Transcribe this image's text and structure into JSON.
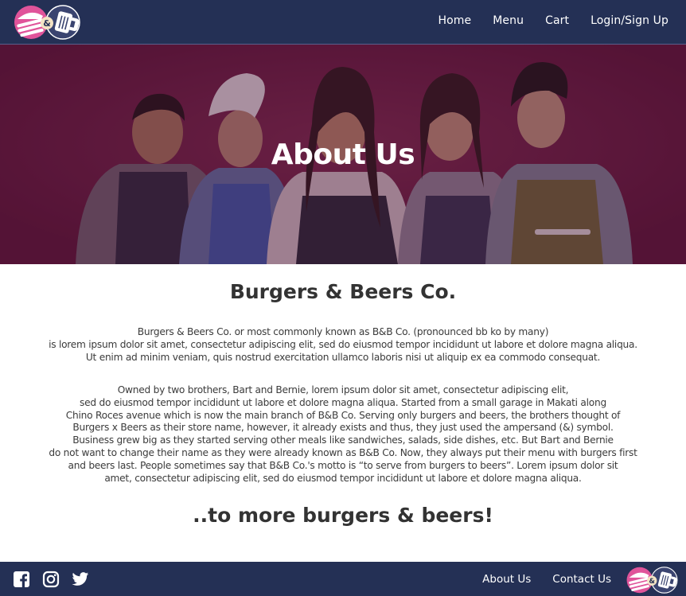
{
  "colors": {
    "navbar_bg": "#243055",
    "hero_overlay": "#5f1a3f",
    "text": "#333333",
    "white": "#ffffff",
    "logo_pink": "#e0549a"
  },
  "header": {
    "logo_icon": "burgers-and-beers-logo",
    "nav": [
      "Home",
      "Menu",
      "Cart",
      "Login/Sign Up"
    ]
  },
  "hero": {
    "title": "About Us",
    "image": "five-smiling-staff-in-aprons"
  },
  "content": {
    "company_name": "Burgers & Beers Co.",
    "paragraph1": [
      "Burgers & Beers Co. or most commonly known as B&B Co. (pronounced bb ko by many)",
      "is lorem ipsum dolor sit amet, consectetur adipiscing elit, sed do eiusmod tempor incididunt ut labore et dolore magna aliqua.",
      "Ut enim ad minim veniam, quis nostrud exercitation ullamco laboris nisi ut aliquip ex ea commodo consequat."
    ],
    "paragraph2": [
      "Owned by two brothers, Bart and Bernie, lorem ipsum dolor sit amet, consectetur adipiscing elit,",
      "sed do eiusmod tempor incididunt ut labore et dolore magna aliqua. Started from a small garage in Makati along",
      "Chino Roces avenue which is now the main branch of B&B Co. Serving only burgers and beers, the brothers thought of",
      "Burgers x Beers as their store name, however, it already exists and thus, they just used the ampersand (&) symbol.",
      "Business grew big as they started serving other meals like sandwiches, salads, side dishes, etc. But Bart and Bernie",
      "do not want to change their name as they were already known as B&B Co. Now, they always put their menu with burgers first",
      "and beers last. People sometimes say that B&B Co.'s motto is “to serve from burgers to beers”. Lorem ipsum dolor sit",
      "amet, consectetur adipiscing elit, sed do eiusmod tempor incididunt ut labore et dolore magna aliqua."
    ],
    "closing": "..to more burgers & beers!"
  },
  "footer": {
    "social_icons": [
      "facebook-icon",
      "instagram-icon",
      "twitter-icon"
    ],
    "links": [
      "About Us",
      "Contact Us"
    ],
    "logo_icon": "burgers-and-beers-logo"
  }
}
